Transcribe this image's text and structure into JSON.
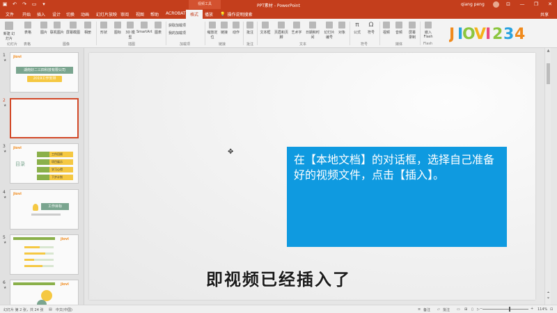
{
  "titlebar": {
    "title": "PPT素材 - PowerPoint",
    "context_tab": "视频工具",
    "user": "qiang peng",
    "minimize": "—",
    "restore": "❐",
    "close": "✕"
  },
  "tabs": {
    "file": "文件",
    "home": "开始",
    "insert": "插入",
    "design": "设计",
    "transitions": "切换",
    "animations": "动画",
    "slideshow": "幻灯片放映",
    "review": "审阅",
    "view": "视图",
    "help": "帮助",
    "acrobat": "ACROBAT",
    "format": "格式",
    "playback": "播放",
    "tell_me": "操作说明搜索",
    "share": "共享"
  },
  "ribbon": {
    "new_slide": "新建\n幻灯片",
    "table": "表格",
    "pictures": "图片",
    "online_pictures": "联机图片",
    "screenshot": "屏幕截图",
    "album": "相册",
    "shapes": "形状",
    "icons": "图标",
    "models_3d": "3D\n模型",
    "smartart": "SmartArt",
    "chart": "图表",
    "store": "获取加载项",
    "my_addins": "我的加载项",
    "zoom": "缩放定\n位",
    "link": "链接",
    "action": "动作",
    "comment": "批注",
    "textbox": "文本框",
    "header_footer": "页眉和页脚",
    "wordart": "艺术字",
    "date_time": "日期和时间",
    "slide_number": "幻灯片\n编号",
    "object": "对象",
    "equation": "公式",
    "symbol": "符号",
    "video": "视频",
    "audio": "音频",
    "screen_recording": "屏幕\n录制",
    "embed_flash": "嵌入\nFlash",
    "groups": {
      "slides": "幻灯片",
      "tables": "表格",
      "images": "图像",
      "illustrations": "插图",
      "addins": "加载项",
      "links": "链接",
      "comments": "批注",
      "text": "文本",
      "symbols": "符号",
      "media": "媒体",
      "flash": "Flash"
    },
    "logo": "JIOVI234"
  },
  "thumbnails": [
    {
      "num": "1",
      "title": "湖南好二三四科技有限公司",
      "subtitle": "2019工作安排",
      "logo": "jiovi"
    },
    {
      "num": "2"
    },
    {
      "num": "3",
      "logo": "jiovi",
      "side": "目录",
      "rows": [
        "工作回顾",
        "项目展示",
        "学习心得",
        "下步计划"
      ]
    },
    {
      "num": "4",
      "logo": "jiovi",
      "title": "工作目标"
    },
    {
      "num": "5",
      "logo": "jiovi"
    },
    {
      "num": "6",
      "logo": "jiovi"
    }
  ],
  "slide": {
    "callout_text": "在【本地文档】的对话框，选择自己准备好的视频文件，点击【插入】。"
  },
  "subtitle": "即视频已经插入了",
  "status": {
    "slide_info": "幻灯片 第 2 张，共 24 张",
    "language": "中文(中国)",
    "notes": "备注",
    "comments": "批注",
    "zoom": "114%"
  },
  "colors": {
    "accent": "#c43e1c",
    "callout": "#0f9ae0"
  }
}
